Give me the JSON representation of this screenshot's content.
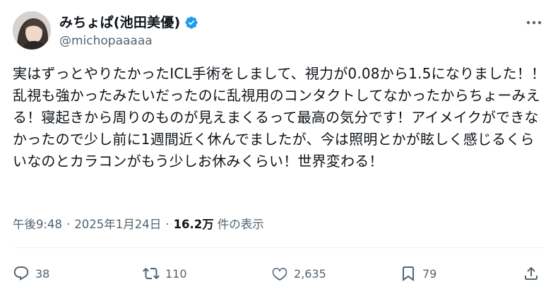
{
  "author": {
    "display_name": "みちょぱ(池田美優)",
    "handle": "@michopaaaaa",
    "verified_icon": "verified-badge-icon",
    "verified_color": "#1d9bf0"
  },
  "tweet": {
    "text": "実はずっとやりたかったICL手術をしまして、視力が0.08から1.5になりました！！乱視も強かったみたいだったのに乱視用のコンタクトしてなかったからちょーみえる！寝起きから周りのものが見えまくるって最高の気分です！アイメイクができなかったので少し前に1週間近く休んでましたが、今は照明とかが眩しく感じるくらいなのとカラコンがもう少しお休みくらい！世界変わる！",
    "time": "午後9:48",
    "separator": "·",
    "date": "2025年1月24日",
    "views_count": "16.2万",
    "views_label": "件の表示"
  },
  "actions": {
    "reply": {
      "icon": "reply-icon",
      "count": "38"
    },
    "repost": {
      "icon": "repost-icon",
      "count": "110"
    },
    "like": {
      "icon": "heart-icon",
      "count": "2,635"
    },
    "bookmark": {
      "icon": "bookmark-icon",
      "count": "79"
    },
    "share": {
      "icon": "share-icon"
    }
  },
  "more_icon": "more-options-icon",
  "colors": {
    "text_primary": "#0f1419",
    "text_secondary": "#536471",
    "divider": "#eff3f4"
  }
}
